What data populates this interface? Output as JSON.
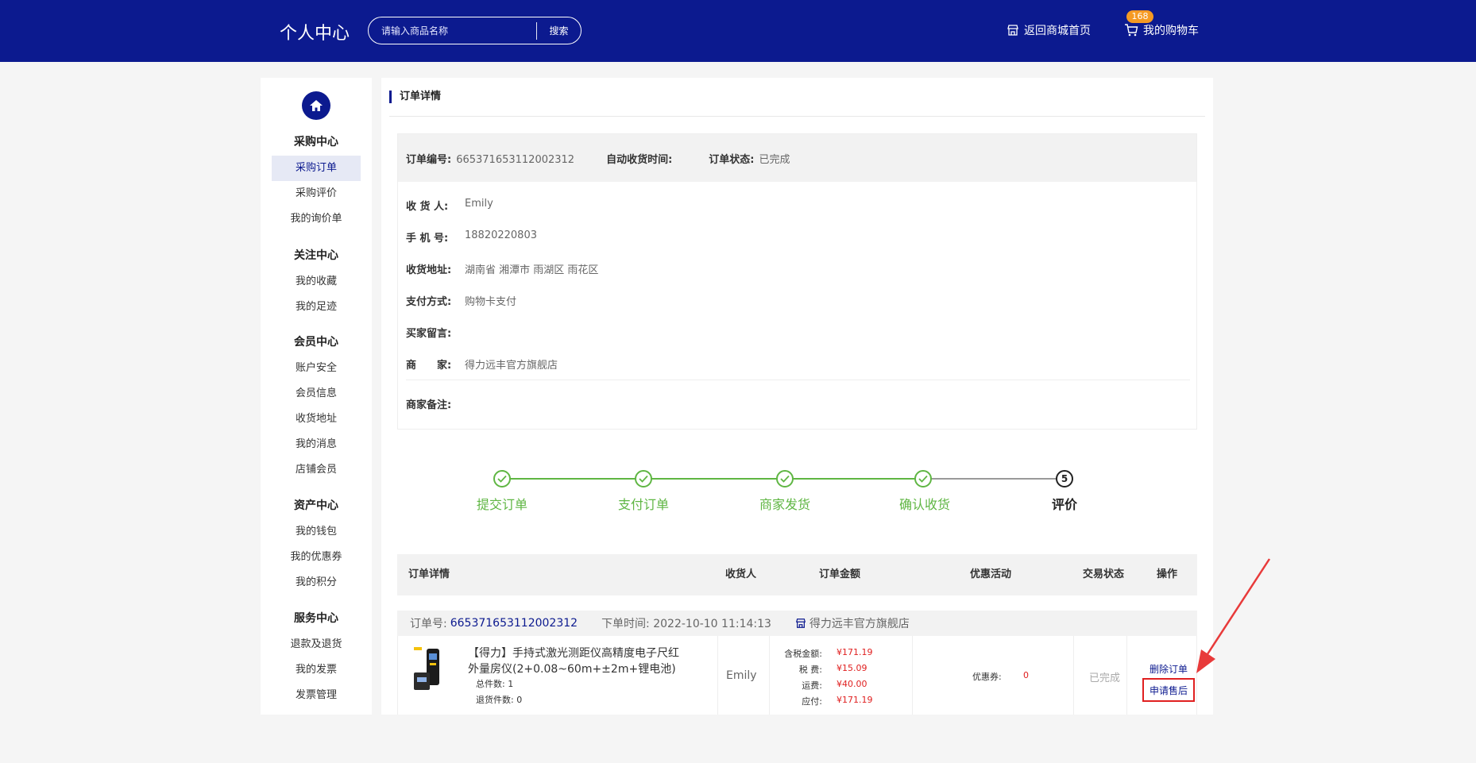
{
  "header": {
    "brand": "个人中心",
    "search_placeholder": "请输入商品名称",
    "search_button": "搜索",
    "home_link": "返回商城首页",
    "cart_link": "我的购物车",
    "cart_count": "168"
  },
  "sidebar": {
    "groups": [
      {
        "title": "采购中心",
        "items": [
          "采购订单",
          "采购评价",
          "我的询价单"
        ]
      },
      {
        "title": "关注中心",
        "items": [
          "我的收藏",
          "我的足迹"
        ]
      },
      {
        "title": "会员中心",
        "items": [
          "账户安全",
          "会员信息",
          "收货地址",
          "我的消息",
          "店铺会员"
        ]
      },
      {
        "title": "资产中心",
        "items": [
          "我的钱包",
          "我的优惠券",
          "我的积分"
        ]
      },
      {
        "title": "服务中心",
        "items": [
          "退款及退货",
          "我的发票",
          "发票管理"
        ]
      }
    ],
    "active_item": "采购订单"
  },
  "page": {
    "title": "订单详情"
  },
  "order_info": {
    "order_no_label": "订单编号:",
    "order_no": "665371653112002312",
    "auto_receive_label": "自动收货时间:",
    "auto_receive_value": "",
    "status_label": "订单状态:",
    "status": "已完成",
    "rows": [
      {
        "label": "收 货 人:",
        "value": "Emily"
      },
      {
        "label": "手 机 号:",
        "value": "18820220803"
      },
      {
        "label": "收货地址:",
        "value": "湖南省 湘潭市 雨湖区 雨花区"
      },
      {
        "label": "支付方式:",
        "value": "购物卡支付"
      },
      {
        "label": "买家留言:",
        "value": ""
      },
      {
        "label": "商　　家:",
        "value": "得力远丰官方旗舰店"
      }
    ],
    "merchant_note_label": "商家备注:",
    "merchant_note": ""
  },
  "progress": {
    "steps": [
      "提交订单",
      "支付订单",
      "商家发货",
      "确认收货",
      "评价"
    ],
    "completed": 4,
    "current_number": "5"
  },
  "table": {
    "headers": [
      "订单详情",
      "收货人",
      "订单金额",
      "优惠活动",
      "交易状态",
      "操作"
    ],
    "order_no_label": "订单号:",
    "order_no": "665371653112002312",
    "order_time": "下单时间: 2022-10-10 11:14:13",
    "store": "得力远丰官方旗舰店",
    "item": {
      "name": "【得力】手持式激光测距仪高精度电子尺红外量房仪(2+0.08~60m+±2m+锂电池)",
      "total_qty": "总件数: 1",
      "return_qty": "退货件数: 0",
      "receiver": "Emily",
      "amounts": [
        {
          "label": "含税金额:",
          "value": "¥171.19"
        },
        {
          "label": "税 费:",
          "value": "¥15.09"
        },
        {
          "label": "运费:",
          "value": "¥40.00"
        },
        {
          "label": "应付:",
          "value": "¥171.19"
        }
      ],
      "coupon_label": "优惠券:",
      "coupon_value": "0",
      "status": "已完成",
      "op_delete": "删除订单",
      "op_after_sale": "申请售后"
    }
  },
  "colors": {
    "primary": "#0c1a8f",
    "success": "#5fb643",
    "danger": "#e02020",
    "badge": "#f59a23"
  }
}
